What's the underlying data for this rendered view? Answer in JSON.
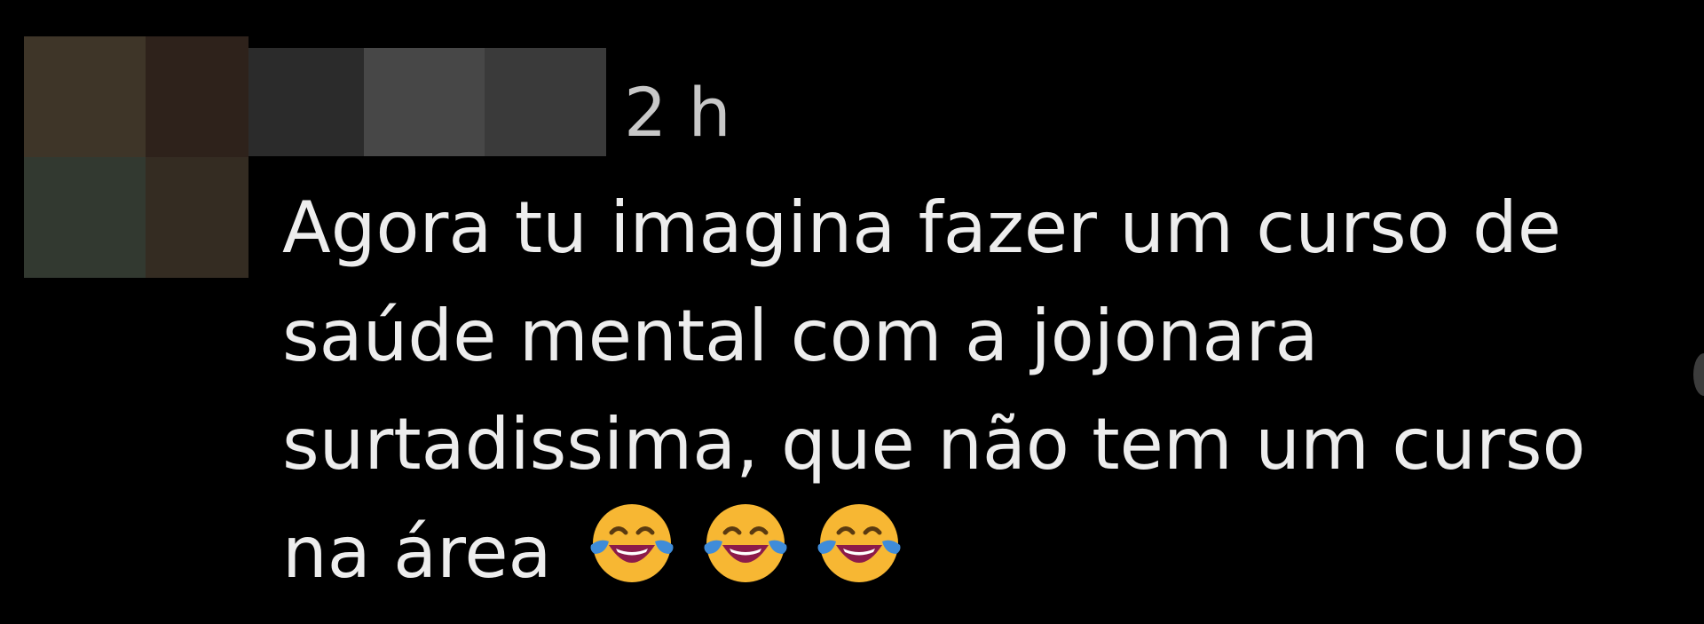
{
  "comment": {
    "timestamp": "2 h",
    "text_lines": [
      "Agora tu imagina fazer um curso de",
      "saúde mental com a jojonara",
      "surtadissima, que não tem um curso",
      "na área"
    ],
    "emojis": [
      {
        "name": "face-with-tears-of-joy-icon"
      },
      {
        "name": "face-with-tears-of-joy-icon"
      },
      {
        "name": "face-with-tears-of-joy-icon"
      }
    ]
  },
  "colors": {
    "background": "#000000",
    "text": "#ededed",
    "timestamp": "#c8c8c8",
    "emoji_face": "#f7b733",
    "emoji_tears": "#3f8cd9",
    "emoji_mouth": "#8c1b4a"
  }
}
